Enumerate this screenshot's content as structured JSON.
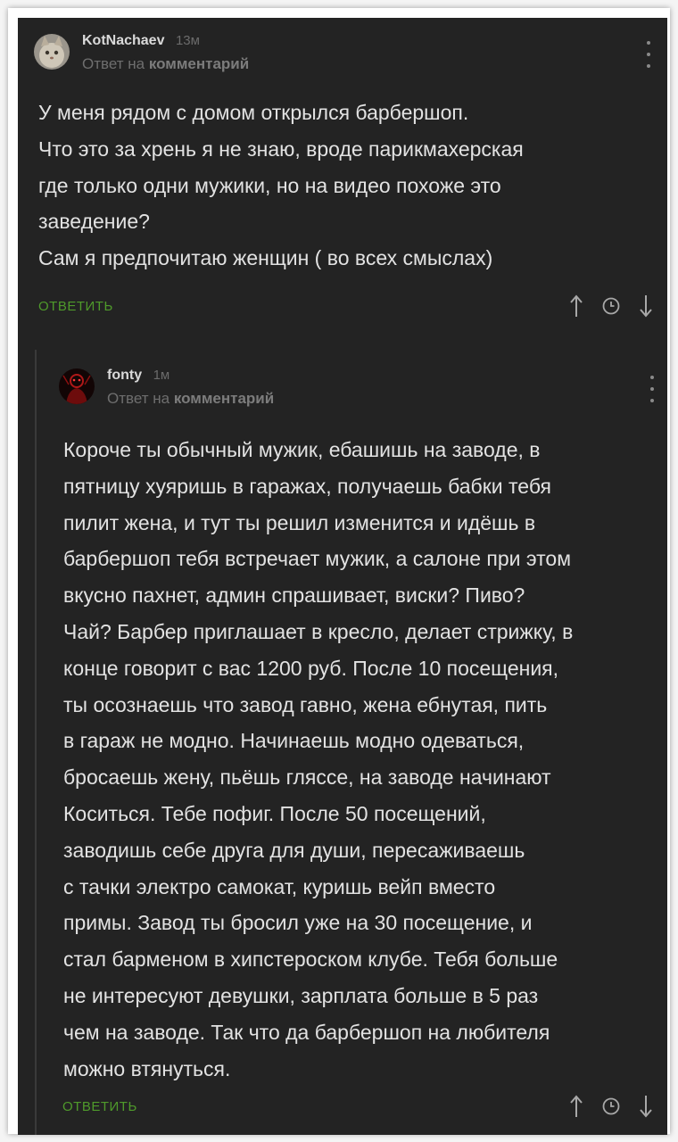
{
  "comments": [
    {
      "username": "KotNachaev",
      "time": "13м",
      "reply_prefix": "Ответ на",
      "reply_target": "комментарий",
      "body": "У меня рядом с домом открылся барбершоп.\nЧто это за хрень я не знаю, вроде парикмахерская\nгде только одни мужики, но на видео похоже это\nзаведение?\nСам я предпочитаю женщин ( во всех смыслах)",
      "reply_button": "ОТВЕТИТЬ"
    },
    {
      "username": "fonty",
      "time": "1м",
      "reply_prefix": "Ответ на",
      "reply_target": "комментарий",
      "body": "Короче ты обычный мужик, ебашишь на заводе, в\nпятницу хуяришь в гаражах, получаешь бабки тебя\nпилит жена, и тут ты решил изменится и идёшь в\nбарбершоп тебя встречает мужик, а салоне при этом\nвкусно пахнет, админ спрашивает, виски? Пиво?\nЧай? Барбер приглашает в кресло, делает стрижку, в\nконце говорит с вас 1200 руб. После 10 посещения,\nты осознаешь что завод гавно, жена ебнутая, пить\nв гараж не модно. Начинаешь модно одеваться,\nбросаешь жену, пьёшь гляссе, на заводе начинают\nКоситься. Тебе пофиг. После 50 посещений,\nзаводишь себе друга для души, пересаживаешь\nс тачки электро самокат, куришь вейп вместо\nпримы. Завод ты бросил уже на 30 посещение, и\nстал барменом в хипстероском клубе. Тебя больше\nне интересуют девушки, зарплата больше в 5 раз\nчем на заводе. Так что да барбершоп на любителя\nможно втянуться.",
      "reply_button": "ОТВЕТИТЬ"
    }
  ],
  "icons": {
    "upvote": "arrow-up-icon",
    "save": "clock-icon",
    "downvote": "arrow-down-icon",
    "menu": "kebab-menu-icon"
  },
  "colors": {
    "background": "#232323",
    "text": "#e2e2e2",
    "accent_green": "#4f9a2b",
    "muted": "#6e6e6e"
  }
}
